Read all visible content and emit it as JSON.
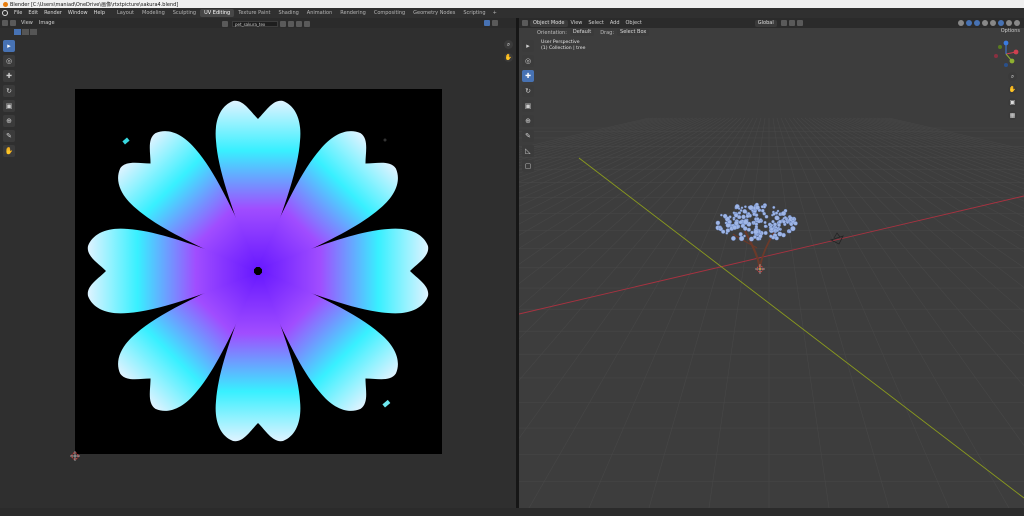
{
  "window": {
    "title": "Blender [C:\\Users\\maniad\\OneDrive\\画像\\rtxtpicture\\sakura4.blend]"
  },
  "menu": {
    "items": [
      "File",
      "Edit",
      "Render",
      "Window",
      "Help"
    ]
  },
  "workspaces": {
    "tabs": [
      "Layout",
      "Modeling",
      "Sculpting",
      "UV Editing",
      "Texture Paint",
      "Shading",
      "Animation",
      "Rendering",
      "Compositing",
      "Geometry Nodes",
      "Scripting"
    ],
    "active": "UV Editing",
    "add": "+"
  },
  "uv_editor": {
    "menus": [
      "View",
      "Image"
    ],
    "image_name": "pet_sakura_tex",
    "tools": [
      "select",
      "cursor",
      "move",
      "rotate",
      "scale",
      "transform",
      "annotate",
      "grab"
    ],
    "uv_colors": {
      "light": "#dff3ff",
      "cyan": "#38f0ff",
      "purple": "#a04dff",
      "violet": "#6a1bff"
    }
  },
  "viewport": {
    "mode": "Object Mode",
    "menus": [
      "View",
      "Select",
      "Add",
      "Object"
    ],
    "transform": "Global",
    "orientation_label": "Orientation:",
    "orientation_value": "Default",
    "drag_label": "Drag:",
    "drag_value": "Select Box",
    "options": "Options",
    "hud_line1": "User Perspective",
    "hud_line2": "(1) Collection | tree",
    "colors": {
      "x_axis": "#a83240",
      "y_axis": "#8a9a1e",
      "blossom": "#9fb6e6",
      "trunk": "#6b3a2a"
    }
  }
}
